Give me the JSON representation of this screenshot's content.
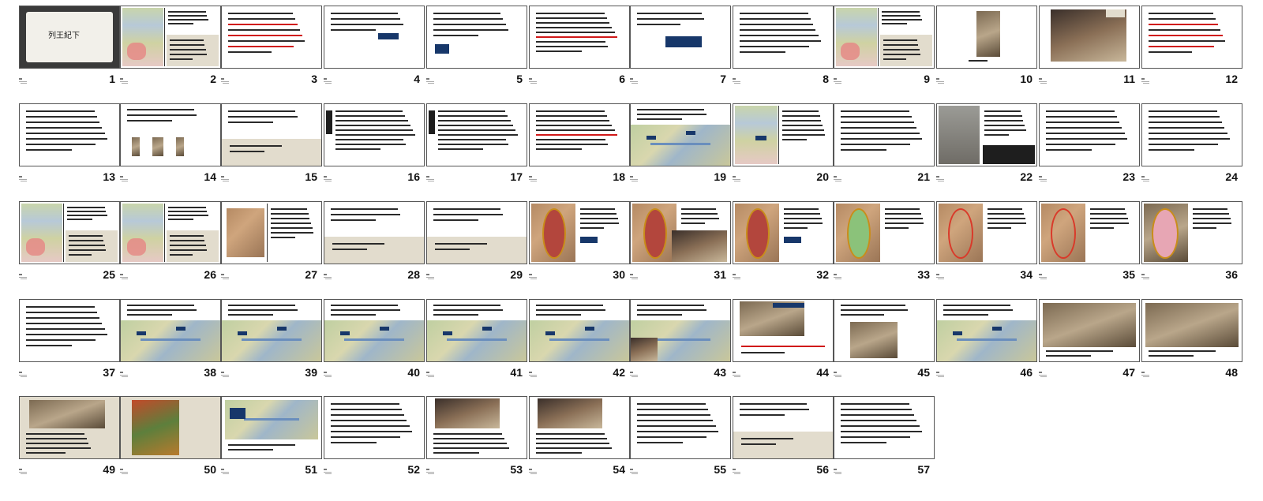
{
  "view": "slide-sorter",
  "slide_count": 57,
  "slides": [
    {
      "number": "1",
      "title": "列王紀下"
    },
    {
      "number": "2"
    },
    {
      "number": "3"
    },
    {
      "number": "4"
    },
    {
      "number": "5"
    },
    {
      "number": "6"
    },
    {
      "number": "7"
    },
    {
      "number": "8"
    },
    {
      "number": "9"
    },
    {
      "number": "10"
    },
    {
      "number": "11"
    },
    {
      "number": "12"
    },
    {
      "number": "13"
    },
    {
      "number": "14"
    },
    {
      "number": "15"
    },
    {
      "number": "16"
    },
    {
      "number": "17"
    },
    {
      "number": "18"
    },
    {
      "number": "19"
    },
    {
      "number": "20"
    },
    {
      "number": "21"
    },
    {
      "number": "22"
    },
    {
      "number": "23"
    },
    {
      "number": "24"
    },
    {
      "number": "25"
    },
    {
      "number": "26"
    },
    {
      "number": "27"
    },
    {
      "number": "28"
    },
    {
      "number": "29"
    },
    {
      "number": "30"
    },
    {
      "number": "31"
    },
    {
      "number": "32"
    },
    {
      "number": "33"
    },
    {
      "number": "34"
    },
    {
      "number": "35"
    },
    {
      "number": "36"
    },
    {
      "number": "37"
    },
    {
      "number": "38"
    },
    {
      "number": "39"
    },
    {
      "number": "40"
    },
    {
      "number": "41"
    },
    {
      "number": "42"
    },
    {
      "number": "43"
    },
    {
      "number": "44"
    },
    {
      "number": "45"
    },
    {
      "number": "46"
    },
    {
      "number": "47"
    },
    {
      "number": "48"
    },
    {
      "number": "49"
    },
    {
      "number": "50"
    },
    {
      "number": "51"
    },
    {
      "number": "52"
    },
    {
      "number": "53"
    },
    {
      "number": "54"
    },
    {
      "number": "55"
    },
    {
      "number": "56"
    },
    {
      "number": "57"
    }
  ]
}
